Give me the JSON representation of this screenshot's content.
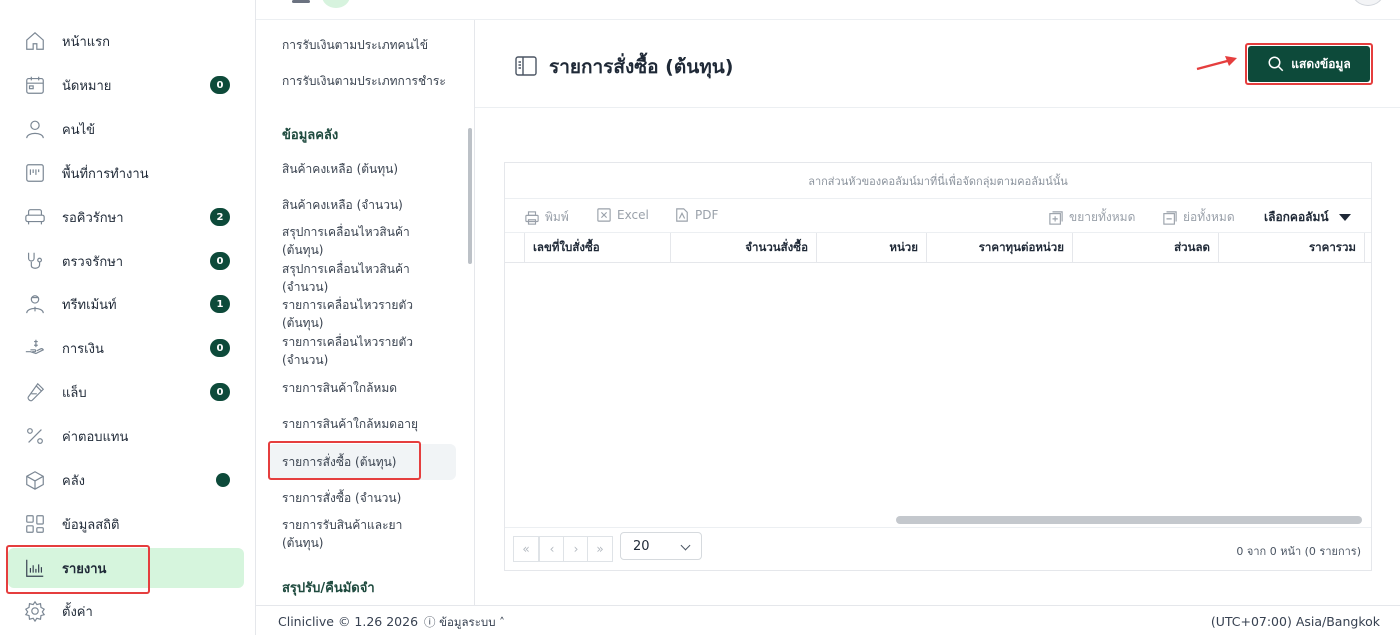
{
  "sidebar": {
    "items": [
      {
        "label": "หน้าแรก",
        "icon": "home-icon"
      },
      {
        "label": "นัดหมาย",
        "icon": "calendar-icon",
        "badge": "0"
      },
      {
        "label": "คนไข้",
        "icon": "user-icon"
      },
      {
        "label": "พื้นที่การทำงาน",
        "icon": "workspace-icon"
      },
      {
        "label": "รอคิวรักษา",
        "icon": "sofa-icon",
        "badge": "2"
      },
      {
        "label": "ตรวจรักษา",
        "icon": "stethoscope-icon",
        "badge": "0"
      },
      {
        "label": "ทรีทเม้นท์",
        "icon": "doctor-icon",
        "badge": "1"
      },
      {
        "label": "การเงิน",
        "icon": "money-hand-icon",
        "badge": "0"
      },
      {
        "label": "แล็บ",
        "icon": "test-tube-icon",
        "badge": "0"
      },
      {
        "label": "ค่าตอบแทน",
        "icon": "percent-icon"
      },
      {
        "label": "คลัง",
        "icon": "box-icon",
        "dot": true
      },
      {
        "label": "ข้อมูลสถิติ",
        "icon": "grid-icon"
      },
      {
        "label": "รายงาน",
        "icon": "report-chart-icon",
        "active": true
      },
      {
        "label": "ตั้งค่า",
        "icon": "gear-icon"
      }
    ]
  },
  "submenu": {
    "top_items": [
      "การรับเงินตามประเภทคนไข้",
      "การรับเงินตามประเภทการชำระ"
    ],
    "heading_inventory": "ข้อมูลคลัง",
    "inventory_items": [
      "สินค้าคงเหลือ (ต้นทุน)",
      "สินค้าคงเหลือ (จำนวน)",
      "สรุปการเคลื่อนไหวสินค้า (ต้นทุน)",
      "สรุปการเคลื่อนไหวสินค้า (จำนวน)",
      "รายการเคลื่อนไหวรายตัว (ต้นทุน)",
      "รายการเคลื่อนไหวรายตัว (จำนวน)",
      "รายการสินค้าใกล้หมด",
      "รายการสินค้าใกล้หมดอายุ",
      "รายการสั่งซื้อ (ต้นทุน)",
      "รายการสั่งซื้อ (จำนวน)",
      "รายการรับสินค้าและยา (ต้นทุน)"
    ],
    "heading_summary": "สรุปรับ/คืนมัดจำ"
  },
  "main": {
    "title": "รายการสั่งซื้อ (ต้นทุน)",
    "show_button": "แสดงข้อมูล",
    "grid": {
      "group_panel": "ลากส่วนหัวของคอลัมน์มาที่นี่เพื่อจัดกลุ่มตามคอลัมน์นั้น",
      "toolbar": {
        "print": "พิมพ์",
        "excel": "Excel",
        "pdf": "PDF",
        "expand_all": "ขยายทั้งหมด",
        "collapse_all": "ย่อทั้งหมด",
        "choose_columns": "เลือกคอลัมน์"
      },
      "columns": [
        "เลขที่ใบสั่งซื้อ",
        "จำนวนสั่งซื้อ",
        "หน่วย",
        "ราคาทุนต่อหน่วย",
        "ส่วนลด",
        "ราคารวม"
      ],
      "pager": {
        "first": "«",
        "prev": "‹",
        "next": "›",
        "last": "»",
        "page_size": "20",
        "info": "0 จาก 0 หน้า (0 รายการ)"
      }
    }
  },
  "footer": {
    "version": "Cliniclive © 1.26 2026",
    "system_info": "ⓘ ข้อมูลระบบ ˄",
    "timezone": "(UTC+07:00) Asia/Bangkok"
  },
  "colors": {
    "brand": "#0d4a3a",
    "active_bg": "#d6f5dd",
    "highlight": "#e53e3e"
  }
}
